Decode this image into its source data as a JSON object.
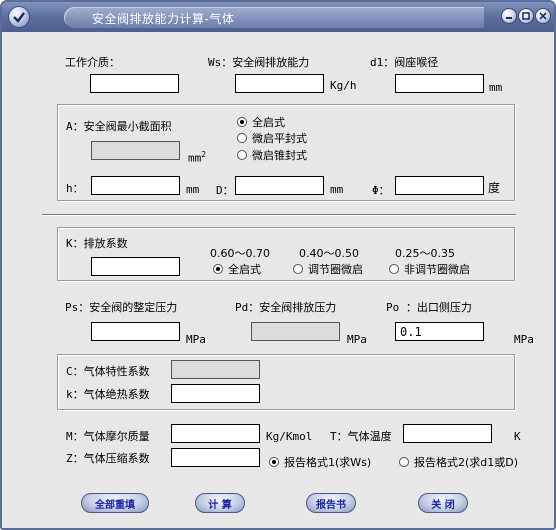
{
  "window": {
    "title": "安全阀排放能力计算-气体"
  },
  "header_labels": {
    "medium": "工作介质：",
    "ws": "Ws：安全阀排放能力",
    "ws_unit": "Kg/h",
    "d1": "d1：阀座喉径",
    "d1_unit": "mm"
  },
  "area_group": {
    "label": "A：安全阀最小截面积",
    "unit": "mm",
    "unit_sup": "2",
    "types": [
      {
        "label": "全启式",
        "selected": true
      },
      {
        "label": "微启平封式",
        "selected": false
      },
      {
        "label": "微启锥封式",
        "selected": false
      }
    ],
    "h_label": "h：",
    "h_unit": "mm",
    "d_label": "D：",
    "d_unit": "mm",
    "phi_label": "Φ：",
    "phi_unit": "度"
  },
  "k_group": {
    "label": "K：排放系数",
    "ranges": [
      "0.60～0.70",
      "0.40～0.50",
      "0.25～0.35"
    ],
    "options": [
      {
        "label": "全启式",
        "selected": true
      },
      {
        "label": "调节圈微启",
        "selected": false
      },
      {
        "label": "非调节圈微启",
        "selected": false
      }
    ]
  },
  "pressure": {
    "ps_label": "Ps：安全阀的整定压力",
    "pd_label": "Pd：安全阀排放压力",
    "po_label": "Po ：出口侧压力",
    "unit": "MPa",
    "po_value": "0.1"
  },
  "gas_group": {
    "c_label": "C：气体特性系数",
    "k_label": "k：气体绝热系数"
  },
  "bottom": {
    "m_label": "M：气体摩尔质量",
    "m_unit": "Kg/Kmol",
    "t_label": "T：气体温度",
    "t_unit": "K",
    "z_label": "Z：气体压缩系数",
    "report_options": [
      {
        "label": "报告格式1(求Ws)",
        "selected": true
      },
      {
        "label": "报告格式2(求d1或D)",
        "selected": false
      }
    ]
  },
  "buttons": {
    "reset": "全部重填",
    "calc": "计  算",
    "report": "报告书",
    "close": "关  闭"
  },
  "colors": {
    "title_bar": "#5a6c9a",
    "button_text": "#1a22a8",
    "window_bg": "#e7e7e7"
  }
}
